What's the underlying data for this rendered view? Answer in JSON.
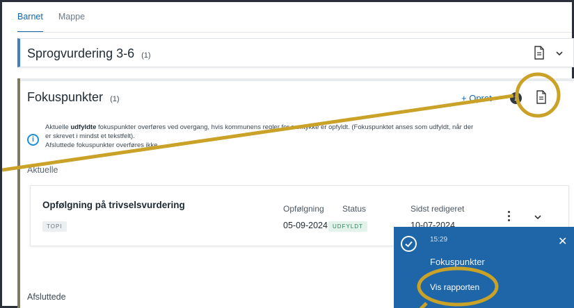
{
  "tabs": [
    {
      "label": "Barnet"
    },
    {
      "label": "Mappe"
    }
  ],
  "sprogvurdering": {
    "title": "Sprogvurdering 3-6",
    "count": "(1)"
  },
  "fokuspunkter": {
    "title": "Fokuspunkter",
    "count": "(1)",
    "create_label": "+ Opret",
    "note_prefix": "Aktuelle ",
    "note_bold": "udfyldte",
    "note_line1_rest": " fokuspunkter overføres ved overgang, hvis kommunens regler for samtykke er opfyldt. (Fokuspunktet anses som udfyldt, når der",
    "note_line2": "er skrevet i mindst et tekstfelt).",
    "note_line3": "Afsluttede fokuspunkter overføres ikke.",
    "current_heading": "Aktuelle",
    "closed_heading": "Afsluttede"
  },
  "item": {
    "title": "Opfølgning på trivselsvurdering",
    "tag": "TOPI",
    "followup_label": "Opfølgning",
    "followup_value": "05-09-2024",
    "status_label": "Status",
    "status_value": "UDFYLDT",
    "edited_label": "Sidst redigeret",
    "edited_value": "10-07-2024"
  },
  "toast": {
    "time": "15:29",
    "title": "Fokuspunkter",
    "link": "Vis rapporten",
    "close": "✕"
  },
  "icons": {
    "document": "document-icon",
    "chevron": "chevron-down-icon",
    "info": "info-icon",
    "check": "check-circle-icon",
    "kebab": "kebab-menu-icon"
  },
  "colors": {
    "accent": "#1266ab",
    "toast_bg": "#1f66a8",
    "annotation": "#c9a227",
    "status_green": "#2e7d5b"
  }
}
